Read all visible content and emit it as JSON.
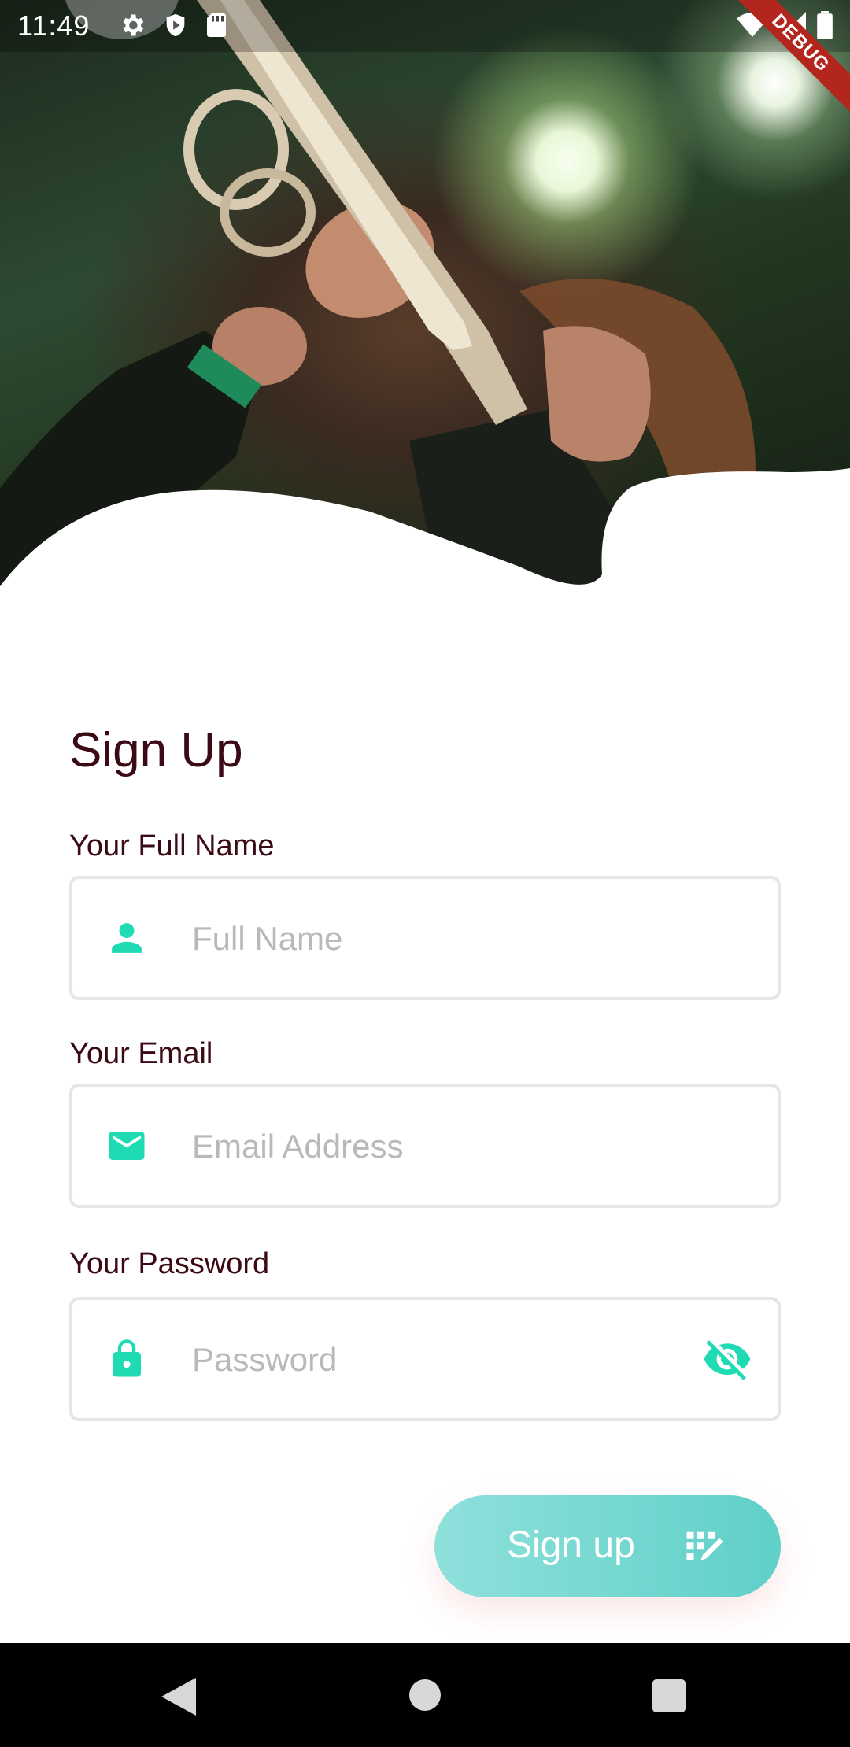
{
  "status_bar": {
    "time": "11:49",
    "left_icons": [
      "settings-icon",
      "shield-play-icon",
      "sd-card-icon"
    ],
    "right_icons": [
      "wifi-icon",
      "signal-icon",
      "battery-icon"
    ],
    "debug_label": "DEBUG"
  },
  "form": {
    "title": "Sign Up",
    "full_name": {
      "label": "Your Full Name",
      "placeholder": "Full Name",
      "value": "",
      "icon": "person-icon"
    },
    "email": {
      "label": "Your Email",
      "placeholder": "Email Address",
      "value": "",
      "icon": "mail-icon"
    },
    "password": {
      "label": "Your Password",
      "placeholder": "Password",
      "value": "",
      "icon": "lock-icon",
      "toggle_icon": "eye-off-icon"
    },
    "submit": {
      "label": "Sign up",
      "icon": "edit-note-icon"
    }
  },
  "colors": {
    "accent": "#1fdbb4",
    "title_text": "#3b0a14",
    "button_start": "#8fe0db",
    "button_end": "#5fd0c8",
    "debug_ribbon": "#b3261e"
  },
  "nav_bar": {
    "icons": [
      "back-icon",
      "home-icon",
      "recents-icon"
    ]
  }
}
